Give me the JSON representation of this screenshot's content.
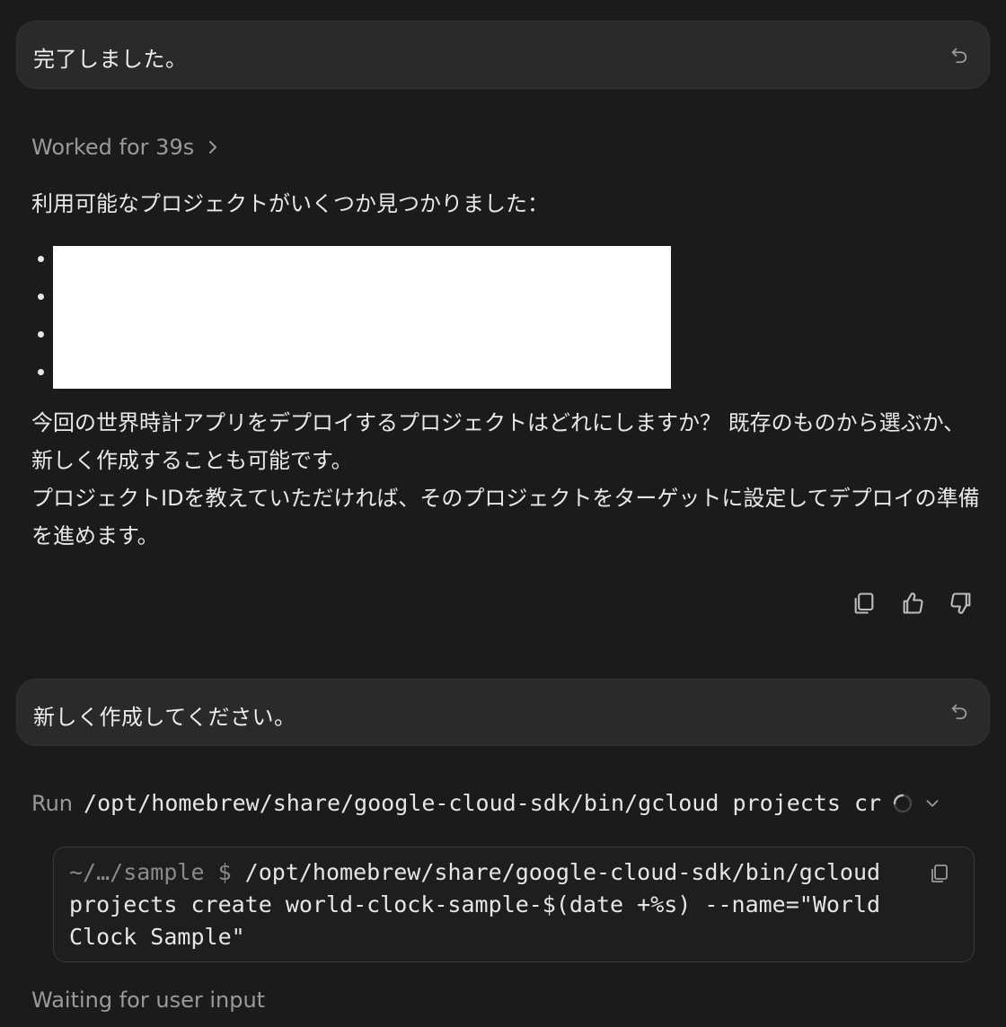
{
  "messages": {
    "user1": "完了しました。",
    "user2": "新しく作成してください。"
  },
  "assistant": {
    "worked": "Worked for 39s",
    "intro": "利用可能なプロジェクトがいくつか見つかりました：",
    "para1": "今回の世界時計アプリをデプロイするプロジェクトはどれにしますか？ 既存のものから選ぶか、新しく作成することも可能です。",
    "para2": "プロジェクトIDを教えていただければ、そのプロジェクトをターゲットに設定してデプロイの準備を進めます。"
  },
  "run": {
    "label": "Run",
    "command": "/opt/homebrew/share/google-cloud-sdk/bin/gcloud projects cr"
  },
  "terminal": {
    "prompt": "~/…/sample $ ",
    "line1": "/opt/homebrew/share/google-cloud-sdk/bin/gcloud",
    "line2": "projects create world-clock-sample-$(date +%s) --name=\"World",
    "line3": "Clock Sample\""
  },
  "status": "Waiting for user input",
  "icons": {
    "undo": "undo-icon",
    "chevron_right": "chevron-right-icon",
    "copy": "copy-icon",
    "thumbs_up": "thumbs-up-icon",
    "thumbs_down": "thumbs-down-icon",
    "spinner": "spinner-icon",
    "chevron_down": "chevron-down-icon"
  }
}
